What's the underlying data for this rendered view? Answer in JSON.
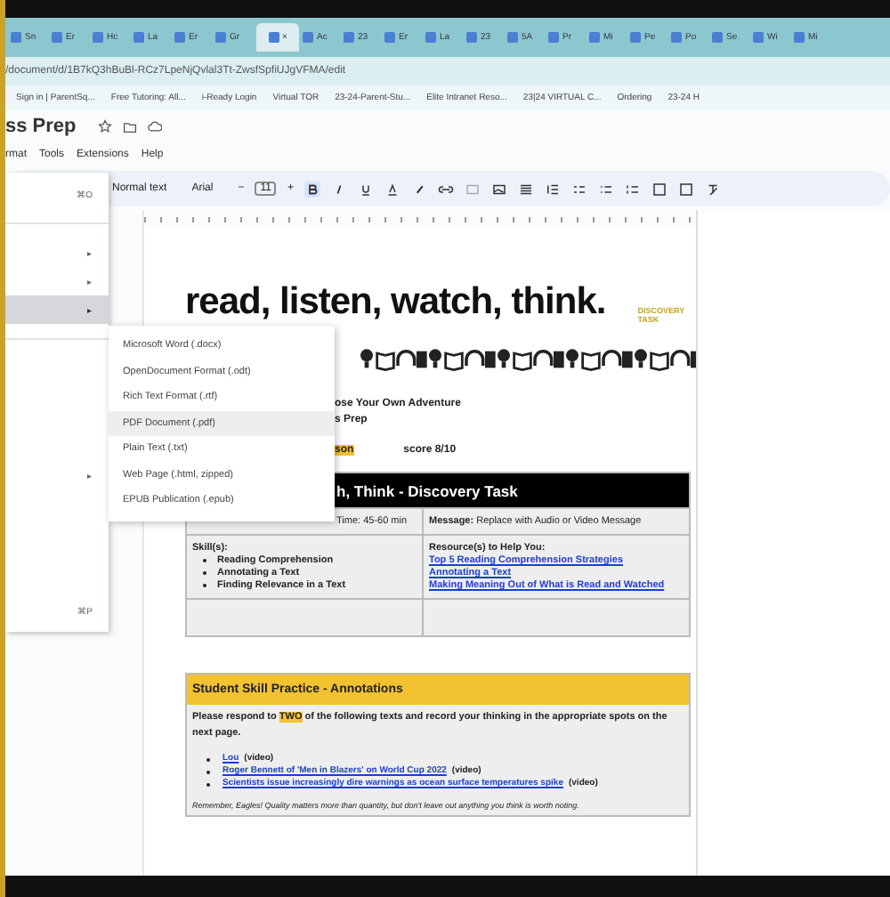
{
  "browser": {
    "tabs": [
      {
        "label": "Sn",
        "selected": false
      },
      {
        "label": "Er",
        "selected": false
      },
      {
        "label": "Hc",
        "selected": false
      },
      {
        "label": "La",
        "selected": false
      },
      {
        "label": "Er",
        "selected": false
      },
      {
        "label": "Gr",
        "selected": false
      },
      {
        "label": "×",
        "selected": true
      },
      {
        "label": "Ac",
        "selected": false
      },
      {
        "label": "23",
        "selected": false
      },
      {
        "label": "Er",
        "selected": false
      },
      {
        "label": "La",
        "selected": false
      },
      {
        "label": "23",
        "selected": false
      },
      {
        "label": "5A",
        "selected": false
      },
      {
        "label": "Pr",
        "selected": false
      },
      {
        "label": "Mi",
        "selected": false
      },
      {
        "label": "Pe",
        "selected": false
      },
      {
        "label": "Po",
        "selected": false
      },
      {
        "label": "Se",
        "selected": false
      },
      {
        "label": "Wi",
        "selected": false
      },
      {
        "label": "Mi",
        "selected": false
      }
    ],
    "address": "/document/d/1B7kQ3hBuBl-RCz7LpeNjQvlal3Tt-ZwsfSpfiUJgVFMA/edit",
    "bookmarks": [
      "Sign in | ParentSq...",
      "Free Tutoring: All...",
      "i-Ready Login",
      "Virtual TOR",
      "23-24-Parent-Stu...",
      "Elite Intranet Reso...",
      "23|24 VIRTUAL C...",
      "Ordering",
      "23-24 H"
    ]
  },
  "document": {
    "title": "ss Prep",
    "menu": [
      "rmat",
      "Tools",
      "Extensions",
      "Help"
    ]
  },
  "toolbar": {
    "style": "Normal text",
    "font": "Arial",
    "minus": "−",
    "size": "11",
    "plus": "+"
  },
  "file_menu": {
    "rows": [
      {
        "kind": "shortcut",
        "text": "⌘O",
        "highlighted": false
      },
      {
        "kind": "divider"
      },
      {
        "kind": "submenu",
        "text": "▸",
        "highlighted": false
      },
      {
        "kind": "submenu",
        "text": "▸",
        "highlighted": false
      },
      {
        "kind": "submenu",
        "text": "▸",
        "highlighted": true
      },
      {
        "kind": "divider"
      },
      {
        "kind": "spacer"
      },
      {
        "kind": "submenu",
        "text": "▸",
        "highlighted": false
      },
      {
        "kind": "spacer"
      },
      {
        "kind": "shortcut",
        "text": "⌘P",
        "highlighted": false
      }
    ]
  },
  "download_menu": {
    "items": [
      {
        "label": "Microsoft Word (.docx)",
        "highlighted": false
      },
      {
        "label": "OpenDocument Format (.odt)",
        "highlighted": false
      },
      {
        "label": "Rich Text Format (.rtf)",
        "highlighted": false
      },
      {
        "label": "PDF Document (.pdf)",
        "highlighted": true
      },
      {
        "label": "Plain Text (.txt)",
        "highlighted": false
      },
      {
        "label": "Web Page (.html, zipped)",
        "highlighted": false
      },
      {
        "label": "EPUB Publication (.epub)",
        "highlighted": false
      }
    ]
  },
  "page": {
    "heading": "read, listen, watch, think.",
    "tag": "DISCOVERY TASK",
    "subtitle_1": "ose Your Own Adventure",
    "subtitle_2": "s Prep",
    "highlight": "son",
    "score": "score 8/10",
    "table": {
      "header": "h, Think - Discovery Task",
      "time": "Time: 45-60 min",
      "message": "**Message:** Replace with Audio or Video Message",
      "skills_label": "Skill(s):",
      "skills": [
        "Reading Comprehension",
        "Annotating a Text",
        "Finding Relevance in a Text"
      ],
      "resources_label": "Resource(s) to Help You:",
      "resources": [
        "Top 5 Reading Comprehension Strategies",
        "Annotating a Text",
        "Making Meaning Out of What is Read and Watched"
      ]
    },
    "practice": {
      "title": "Student Skill Practice - Annotations",
      "prompt_before": "Please respond to",
      "prompt_mark": "TWO",
      "prompt_after": "of the following texts and record your thinking in the appropriate spots on the next page.",
      "links": [
        {
          "link": "Lou",
          "note": "(video)"
        },
        {
          "link": "Roger Bennett of 'Men in Blazers' on World Cup 2022",
          "note": "(video)"
        },
        {
          "link": "Scientists issue increasingly dire warnings as ocean surface temperatures spike",
          "note": "(video)"
        }
      ],
      "reminder": "Remember, Eagles! Quality matters more than quantity, but don't leave out anything you think is worth noting."
    }
  }
}
